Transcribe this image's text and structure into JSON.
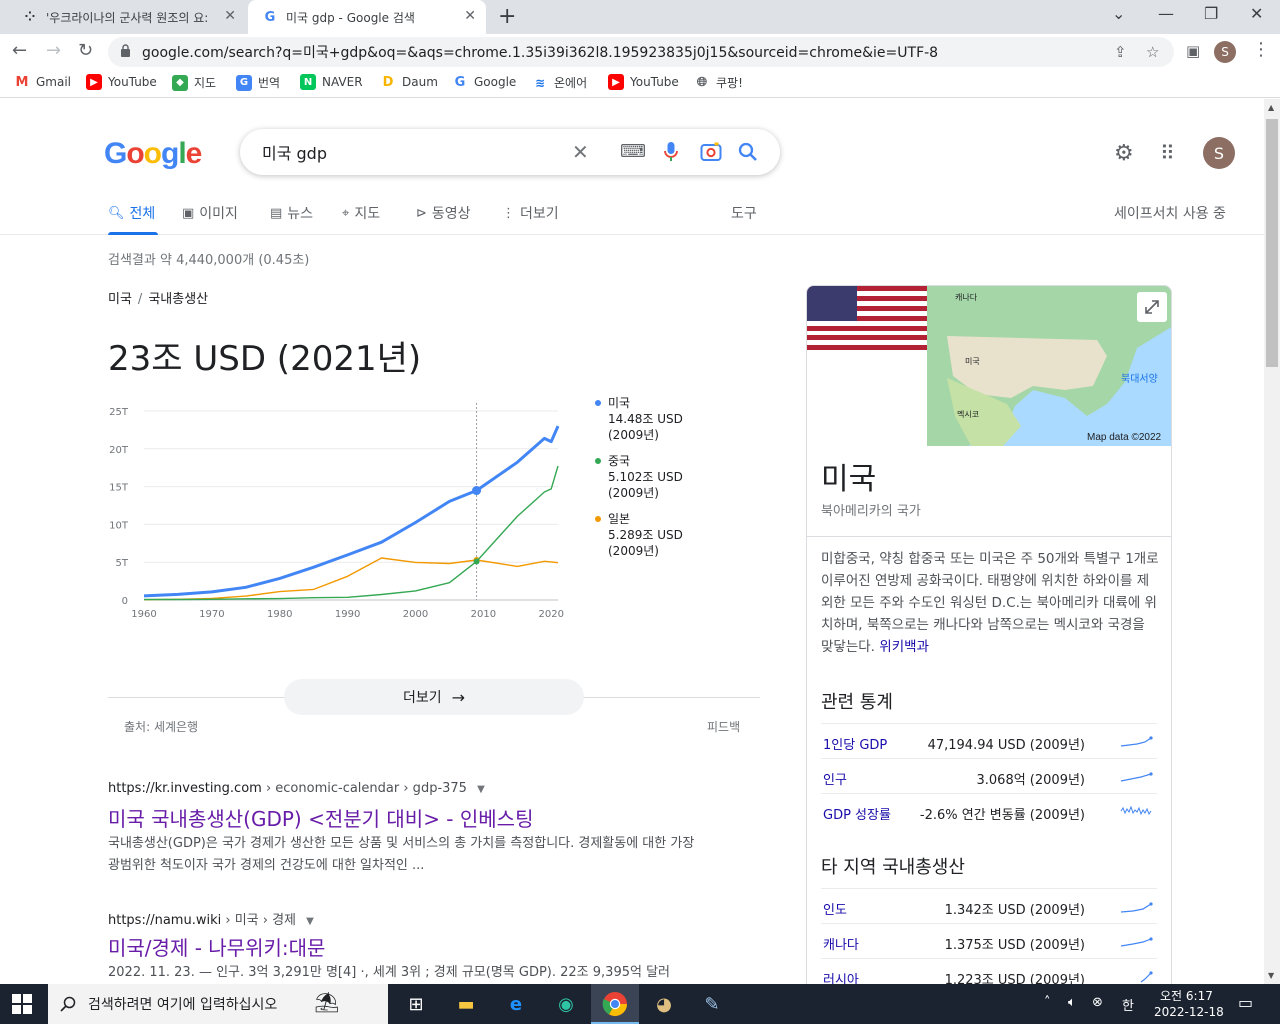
{
  "browser": {
    "tabs": [
      {
        "title": "'우크라이나의 군사력 원조의 요:",
        "active": false
      },
      {
        "title": "미국 gdp - Google 검색",
        "active": true
      }
    ],
    "url": "google.com/search?q=미국+gdp&oq=&aqs=chrome.1.35i39i362l8.195923835j0j15&sourceid=chrome&ie=UTF-8",
    "profile_initial": "S",
    "bookmarks": [
      "Gmail",
      "YouTube",
      "지도",
      "번역",
      "NAVER",
      "Daum",
      "Google",
      "온에어",
      "YouTube",
      "쿠팡!"
    ]
  },
  "google": {
    "logo": "Google",
    "query": "미국 gdp",
    "account_initial": "S",
    "search_tabs": [
      "전체",
      "이미지",
      "뉴스",
      "지도",
      "동영상",
      "더보기"
    ],
    "tools": "도구",
    "safesearch": "세이프서치 사용 중",
    "result_stats": "검색결과 약 4,440,000개 (0.45초)"
  },
  "answer": {
    "breadcrumb": [
      "미국",
      "국내총생산"
    ],
    "value": "23조 USD (2021년)",
    "more": "더보기",
    "source": "출처: 세계은행",
    "feedback": "피드백",
    "legend": [
      {
        "name": "미국",
        "value": "14.48조 USD",
        "year": "(2009년)",
        "color": "#4285f4"
      },
      {
        "name": "중국",
        "value": "5.102조 USD",
        "year": "(2009년)",
        "color": "#34a853"
      },
      {
        "name": "일본",
        "value": "5.289조 USD",
        "year": "(2009년)",
        "color": "#f29900"
      }
    ]
  },
  "chart_data": {
    "type": "line",
    "title": "",
    "xlabel": "",
    "ylabel": "",
    "x": [
      1960,
      1965,
      1970,
      1975,
      1980,
      1985,
      1990,
      1995,
      2000,
      2005,
      2009,
      2015,
      2019,
      2020,
      2021
    ],
    "xticks": [
      "1960",
      "1970",
      "1980",
      "1990",
      "2000",
      "2010",
      "2020"
    ],
    "yticks": [
      "0",
      "5T",
      "10T",
      "15T",
      "20T",
      "25T"
    ],
    "ylim": [
      0,
      25
    ],
    "series": [
      {
        "name": "미국",
        "values": [
          0.54,
          0.74,
          1.07,
          1.68,
          2.86,
          4.34,
          5.96,
          7.64,
          10.25,
          13.04,
          14.48,
          18.21,
          21.38,
          20.95,
          23.0
        ],
        "color": "#4285f4"
      },
      {
        "name": "중국",
        "values": [
          0.06,
          0.07,
          0.09,
          0.16,
          0.19,
          0.31,
          0.36,
          0.73,
          1.21,
          2.29,
          5.1,
          11.06,
          14.28,
          14.69,
          17.73
        ],
        "color": "#34a853"
      },
      {
        "name": "일본",
        "values": [
          0.04,
          0.09,
          0.21,
          0.52,
          1.11,
          1.4,
          3.13,
          5.55,
          4.97,
          4.83,
          5.29,
          4.44,
          5.12,
          5.04,
          4.94
        ],
        "color": "#f29900"
      }
    ],
    "highlight_x": 2009
  },
  "results": [
    {
      "site": "https://kr.investing.com",
      "path": " › economic-calendar › gdp-375",
      "title": "미국 국내총생산(GDP) <전분기 대비> - 인베스팅",
      "snippet": "국내총생산(GDP)은 국가 경제가 생산한 모든 상품 및 서비스의 총 가치를 측정합니다. 경제활동에 대한 가장 광범위한 척도이자 국가 경제의 건강도에 대한 일차적인 ..."
    },
    {
      "site": "https://namu.wiki",
      "path": " › 미국 › 경제",
      "title": "미국/경제 - 나무위키:대문",
      "snippet": "2022. 11. 23. — 인구. 3억 3,291만 명[4] ·, 세계 3위 ; 경제 규모(명목 GDP). 22조 9,395억 달러"
    }
  ],
  "knowledge_panel": {
    "map_labels": [
      "캐나다",
      "미국",
      "멕시코",
      "북대서양"
    ],
    "map_credit": "Map data ©2022",
    "title": "미국",
    "subtitle": "북아메리카의 국가",
    "description": "미합중국, 약칭 합중국 또는 미국은 주 50개와 특별구 1개로 이루어진 연방제 공화국이다. 태평양에 위치한 하와이를 제외한 모든 주와 수도인 워싱턴 D.C.는 북아메리카 대륙에 위치하며, 북쪽으로는 캐나다와 남쪽으로는 멕시코와 국경을 맞닿는다.",
    "wiki_link": "위키백과",
    "stats_heading": "관련 통계",
    "stats": [
      {
        "label": "1인당 GDP",
        "value": "47,194.94 USD (2009년)"
      },
      {
        "label": "인구",
        "value": "3.068억 (2009년)"
      },
      {
        "label": "GDP 성장률",
        "value": "-2.6% 연간 변동률 (2009년)"
      }
    ],
    "other_heading": "타 지역 국내총생산",
    "others": [
      {
        "label": "인도",
        "value": "1.342조 USD (2009년)"
      },
      {
        "label": "캐나다",
        "value": "1.375조 USD (2009년)"
      },
      {
        "label": "러시아",
        "value": "1.223조 USD (2009년)"
      }
    ]
  },
  "taskbar": {
    "search_placeholder": "검색하려면 여기에 입력하십시오",
    "ime": "한",
    "time": "오전 6:17",
    "date": "2022-12-18"
  }
}
